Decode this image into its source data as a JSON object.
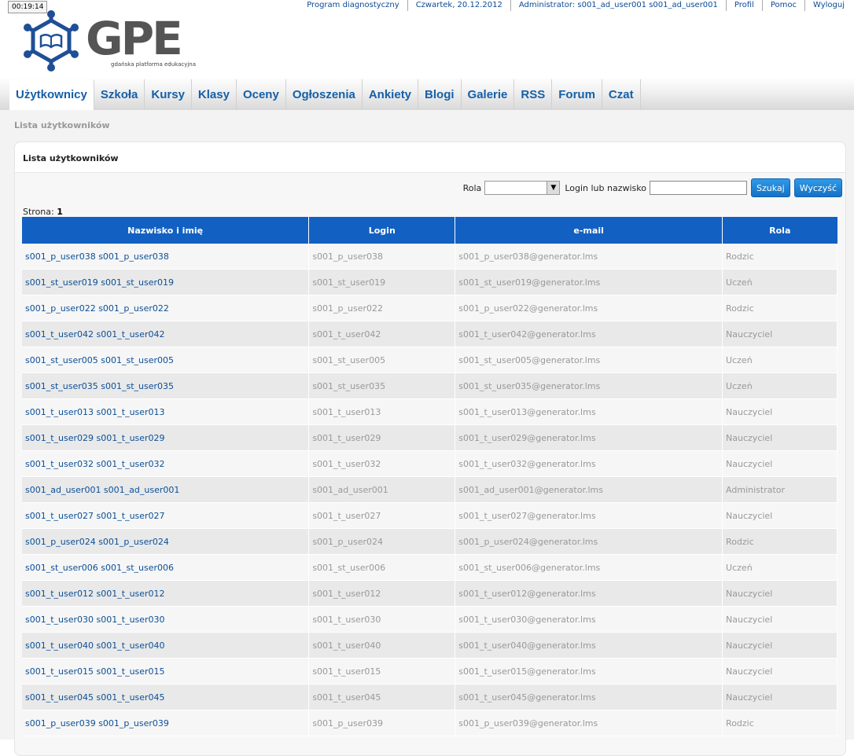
{
  "timer": "00:19:14",
  "topbar": {
    "items": [
      {
        "label": "Program diagnostyczny",
        "link": true
      },
      {
        "label": "Czwartek, 20.12.2012",
        "link": false
      },
      {
        "label": "Administrator: s001_ad_user001 s001_ad_user001",
        "link": false
      },
      {
        "label": "Profil",
        "link": true
      },
      {
        "label": "Pomoc",
        "link": true
      },
      {
        "label": "Wyloguj",
        "link": true
      }
    ]
  },
  "logo": {
    "text": "GPE",
    "tagline": "gdańska platforma edukacyjna",
    "colors": {
      "hex": "#1f4f96",
      "letters": "#555555"
    }
  },
  "nav": {
    "tabs": [
      {
        "label": "Użytkownicy",
        "active": true
      },
      {
        "label": "Szkoła",
        "active": false
      },
      {
        "label": "Kursy",
        "active": false
      },
      {
        "label": "Klasy",
        "active": false
      },
      {
        "label": "Oceny",
        "active": false
      },
      {
        "label": "Ogłoszenia",
        "active": false
      },
      {
        "label": "Ankiety",
        "active": false
      },
      {
        "label": "Blogi",
        "active": false
      },
      {
        "label": "Galerie",
        "active": false
      },
      {
        "label": "RSS",
        "active": false
      },
      {
        "label": "Forum",
        "active": false
      },
      {
        "label": "Czat",
        "active": false
      }
    ]
  },
  "breadcrumb": "Lista użytkowników",
  "panel": {
    "title": "Lista użytkowników",
    "filter": {
      "role_label": "Rola",
      "role_value": "",
      "search_label": "Login lub nazwisko",
      "search_value": "",
      "search_button": "Szukaj",
      "clear_button": "Wyczyść"
    },
    "page_label": "Strona:",
    "page_number": "1",
    "columns": [
      "Nazwisko i imię",
      "Login",
      "e-mail",
      "Rola"
    ],
    "rows": [
      [
        "s001_p_user038 s001_p_user038",
        "s001_p_user038",
        "s001_p_user038@generator.lms",
        "Rodzic"
      ],
      [
        "s001_st_user019 s001_st_user019",
        "s001_st_user019",
        "s001_st_user019@generator.lms",
        "Uczeń"
      ],
      [
        "s001_p_user022 s001_p_user022",
        "s001_p_user022",
        "s001_p_user022@generator.lms",
        "Rodzic"
      ],
      [
        "s001_t_user042 s001_t_user042",
        "s001_t_user042",
        "s001_t_user042@generator.lms",
        "Nauczyciel"
      ],
      [
        "s001_st_user005 s001_st_user005",
        "s001_st_user005",
        "s001_st_user005@generator.lms",
        "Uczeń"
      ],
      [
        "s001_st_user035 s001_st_user035",
        "s001_st_user035",
        "s001_st_user035@generator.lms",
        "Uczeń"
      ],
      [
        "s001_t_user013 s001_t_user013",
        "s001_t_user013",
        "s001_t_user013@generator.lms",
        "Nauczyciel"
      ],
      [
        "s001_t_user029 s001_t_user029",
        "s001_t_user029",
        "s001_t_user029@generator.lms",
        "Nauczyciel"
      ],
      [
        "s001_t_user032 s001_t_user032",
        "s001_t_user032",
        "s001_t_user032@generator.lms",
        "Nauczyciel"
      ],
      [
        "s001_ad_user001 s001_ad_user001",
        "s001_ad_user001",
        "s001_ad_user001@generator.lms",
        "Administrator"
      ],
      [
        "s001_t_user027 s001_t_user027",
        "s001_t_user027",
        "s001_t_user027@generator.lms",
        "Nauczyciel"
      ],
      [
        "s001_p_user024 s001_p_user024",
        "s001_p_user024",
        "s001_p_user024@generator.lms",
        "Rodzic"
      ],
      [
        "s001_st_user006 s001_st_user006",
        "s001_st_user006",
        "s001_st_user006@generator.lms",
        "Uczeń"
      ],
      [
        "s001_t_user012 s001_t_user012",
        "s001_t_user012",
        "s001_t_user012@generator.lms",
        "Nauczyciel"
      ],
      [
        "s001_t_user030 s001_t_user030",
        "s001_t_user030",
        "s001_t_user030@generator.lms",
        "Nauczyciel"
      ],
      [
        "s001_t_user040 s001_t_user040",
        "s001_t_user040",
        "s001_t_user040@generator.lms",
        "Nauczyciel"
      ],
      [
        "s001_t_user015 s001_t_user015",
        "s001_t_user015",
        "s001_t_user015@generator.lms",
        "Nauczyciel"
      ],
      [
        "s001_t_user045 s001_t_user045",
        "s001_t_user045",
        "s001_t_user045@generator.lms",
        "Nauczyciel"
      ],
      [
        "s001_p_user039 s001_p_user039",
        "s001_p_user039",
        "s001_p_user039@generator.lms",
        "Rodzic"
      ]
    ]
  },
  "colors": {
    "header_blue": "#1260c2",
    "link_blue": "#0c4f96",
    "button_blue": "#1f83d6"
  }
}
